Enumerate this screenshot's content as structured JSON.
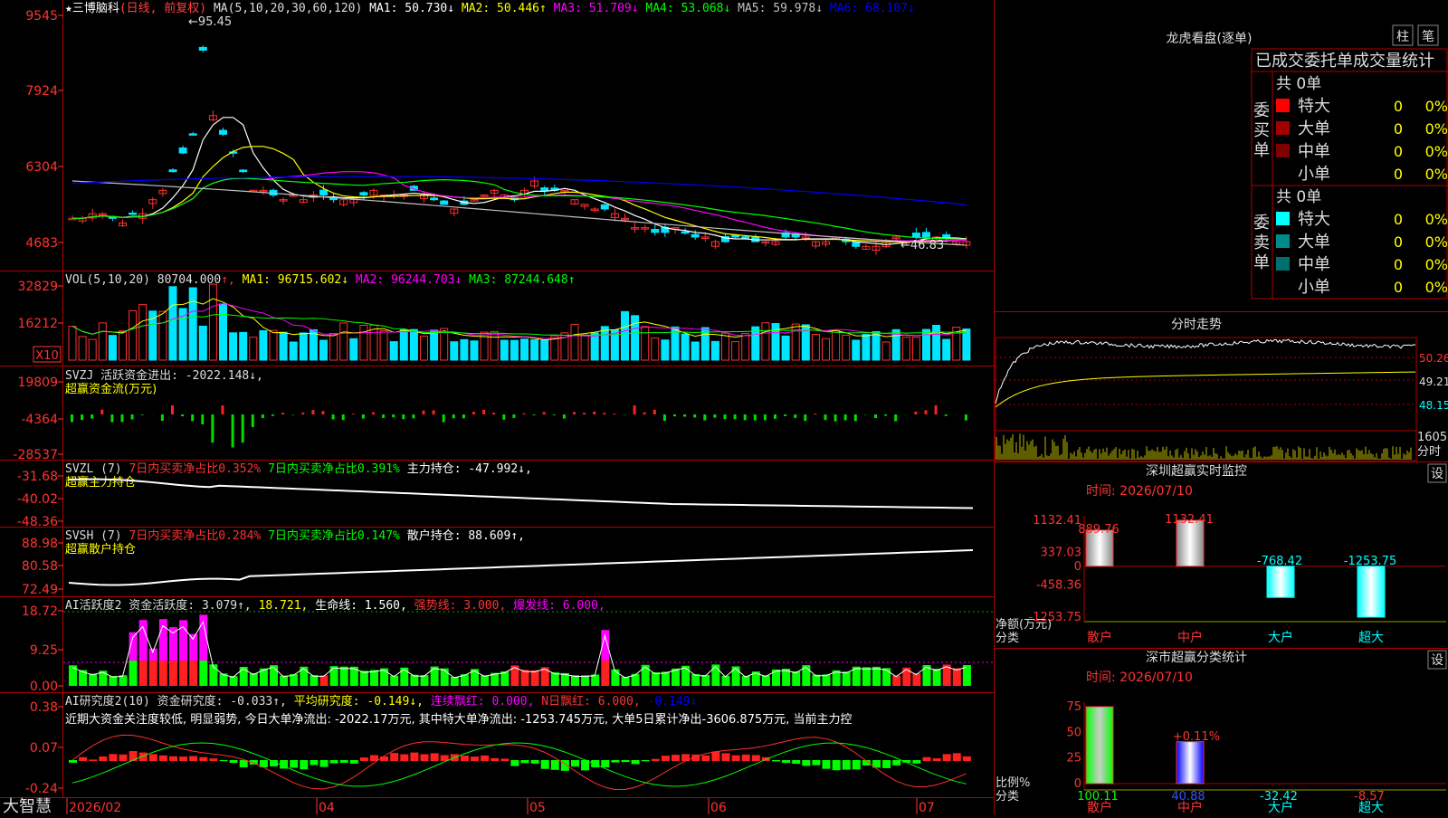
{
  "stock": {
    "name": "三博脑科",
    "period": "(日线, 前复权)"
  },
  "price": {
    "y_ticks": [
      "9545",
      "7924",
      "6304",
      "4683"
    ],
    "ma_label": "MA(5,10,20,30,60,120)",
    "ma_values": [
      {
        "label": "MA1:",
        "value": "50.730",
        "arrow": "↓",
        "color": "#ffffff"
      },
      {
        "label": "MA2:",
        "value": "50.446",
        "arrow": "↑",
        "color": "#ffff00"
      },
      {
        "label": "MA3:",
        "value": "51.709",
        "arrow": "↓",
        "color": "#ff00ff"
      },
      {
        "label": "MA4:",
        "value": "53.068",
        "arrow": "↓",
        "color": "#00ff00"
      },
      {
        "label": "MA5:",
        "value": "59.978",
        "arrow": "↓",
        "color": "#c0c0c0"
      },
      {
        "label": "MA6:",
        "value": "68.107",
        "arrow": "↓",
        "color": "#0000ff"
      }
    ],
    "high_label": "95.45",
    "low_label": "←46.83"
  },
  "volume": {
    "y_ticks": [
      "32829",
      "16212"
    ],
    "unit": "X10",
    "label": "VOL(5,10,20)",
    "value": "80704.000",
    "value_arrow": "↑",
    "ma_values": [
      {
        "label": "MA1:",
        "value": "96715.602",
        "arrow": "↓",
        "color": "#ffff00"
      },
      {
        "label": "MA2:",
        "value": "96244.703",
        "arrow": "↓",
        "color": "#ff00ff"
      },
      {
        "label": "MA3:",
        "value": "87244.648",
        "arrow": "↑",
        "color": "#00ff00"
      }
    ]
  },
  "svzj": {
    "y_ticks": [
      "19809",
      "-4364",
      "-28537"
    ],
    "label": "SVZJ",
    "line1": "活跃资金进出: -2022.148↓,",
    "line2": "超赢资金流(万元)"
  },
  "svzl": {
    "y_ticks": [
      "-31.68",
      "-40.02",
      "-48.36"
    ],
    "label": "SVZL (7)",
    "text_red": "7日内买卖净占比0.352%",
    "text_green": "7日内买卖净占比0.391%",
    "text_white": "主力持仓: -47.992↓,",
    "line2": "超赢主力持仓"
  },
  "svsh": {
    "y_ticks": [
      "88.98",
      "80.58",
      "72.49"
    ],
    "label": "SVSH (7)",
    "text_red": "7日内买卖净占比0.284%",
    "text_green": "7日内买卖净占比0.147%",
    "text_white": "散户持仓: 88.609↑,",
    "line2": "超赢散户持仓"
  },
  "ai_active": {
    "y_ticks": [
      "18.72",
      "9.25",
      "0.00"
    ],
    "label": "AI活跃度2",
    "t1": "资金活跃度: 3.079↑,",
    "t2": "18.721,",
    "t3": "生命线: 1.560,",
    "t4": "强势线: 3.000,",
    "t5": "爆发线: 6.000,"
  },
  "ai_research": {
    "y_ticks": [
      "0.38",
      "0.07",
      "-0.24"
    ],
    "label": "AI研究度2(10)",
    "t1": "资金研究度: -0.033↑,",
    "t2": "平均研究度: -0.149↓,",
    "t3": "连续飘红: 0.000,",
    "t4": "N日飘红: 6.000,",
    "t5": "-0.149↓",
    "comment": "近期大资金关注度较低, 明显弱势, 今日大单净流出: -2022.17万元, 其中特大单净流出: -1253.745万元, 大单5日累计净出-3606.875万元, 当前主力控"
  },
  "x_axis": {
    "labels": [
      "2026/02",
      "04",
      "05",
      "06",
      "07"
    ]
  },
  "bottom_left": "大智慧",
  "lhb": {
    "title": "龙虎看盘(逐单)",
    "btn1": "柱",
    "btn2": "笔",
    "header": "已成交委托单成交量统计",
    "buy_label": "委买单",
    "sell_label": "委卖单",
    "buy_total": "共 0单",
    "sell_total": "共 0单",
    "rows": [
      {
        "name": "特大",
        "count": "0",
        "pct": "0%"
      },
      {
        "name": "大单",
        "count": "0",
        "pct": "0%"
      },
      {
        "name": "中单",
        "count": "0",
        "pct": "0%"
      },
      {
        "name": "小单",
        "count": "0",
        "pct": "0%"
      }
    ],
    "colors": {
      "buy": [
        "#ff0000",
        "#a00000",
        "#800000",
        "#000000"
      ],
      "sell": [
        "#00ffff",
        "#008b8b",
        "#006f6f",
        "#000000"
      ]
    }
  },
  "intraday": {
    "title": "分时走势",
    "y_ticks": [
      "50.26",
      "49.21",
      "48.15"
    ],
    "vol_label": "1605",
    "time_label": "分时"
  },
  "sz_monitor": {
    "title": "深圳超赢实时监控",
    "button": "设",
    "date": "时间: 2026/07/10",
    "y_ticks": [
      "1132.41",
      "337.03",
      "0",
      "-458.36",
      "-1253.75"
    ],
    "ylabel": "净额(万元)",
    "xlabel": "分类",
    "categories": [
      "散户",
      "中户",
      "大户",
      "超大"
    ],
    "value_labels": [
      "889.76",
      "1132.41",
      "-768.42",
      "-1253.75"
    ]
  },
  "sz_class": {
    "title": "深市超赢分类统计",
    "button": "设",
    "date": "时间: 2026/07/10",
    "y_ticks": [
      "75",
      "50",
      "25",
      "0"
    ],
    "ylabel": "比例%",
    "xlabel": "分类",
    "categories": [
      "散户",
      "中户",
      "大户",
      "超大"
    ],
    "value_labels": [
      "100.11",
      "40.88",
      "-32.42",
      "-8.57"
    ],
    "annotation": "+0.11%"
  },
  "chart_data": [
    {
      "type": "bar",
      "title": "深圳超赢实时监控",
      "ylabel": "净额(万元)",
      "xlabel": "分类",
      "categories": [
        "散户",
        "中户",
        "大户",
        "超大"
      ],
      "values": [
        889.76,
        1132.41,
        -768.42,
        -1253.75
      ],
      "ylim": [
        -1253.75,
        1132.41
      ]
    },
    {
      "type": "bar",
      "title": "深市超赢分类统计",
      "ylabel": "比例%",
      "xlabel": "分类",
      "categories": [
        "散户",
        "中户",
        "大户",
        "超大"
      ],
      "values": [
        100.11,
        40.88,
        -32.42,
        -8.57
      ],
      "ylim": [
        0,
        75
      ]
    }
  ]
}
